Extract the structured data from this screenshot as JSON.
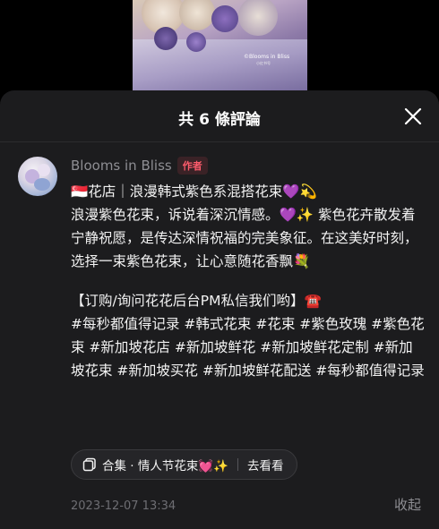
{
  "video": {
    "watermark": "©Blooms in Bliss",
    "watermark_sub": "小红书号"
  },
  "sheet": {
    "title": "共 6 條評論"
  },
  "comment": {
    "author": "Blooms in Bliss",
    "author_badge": "作者",
    "line1": "🇸🇬花店｜浪漫韩式紫色系混搭花束💜💫",
    "line2": "浪漫紫色花束，诉说着深沉情感。💜✨ 紫色花卉散发着宁静祝愿，是传达深情祝福的完美象征。在这美好时刻，选择一束紫色花束，让心意随花香飘💐",
    "line3": "【订购/询问花花后台PM私信我们哟】☎️",
    "hashtags": "#每秒都值得记录 #韩式花束 #花束 #紫色玫瑰 #紫色花束 #新加坡花店 #新加坡鲜花 #新加坡鲜花定制 #新加坡花束 #新加坡买花 #新加坡鲜花配送 #每秒都值得记录",
    "collection_label": "合集 · 情人节花束💓✨",
    "collection_action": "去看看",
    "timestamp": "2023-12-07 13:34",
    "collapse_label": "收起"
  },
  "colors": {
    "sheet_bg": "#1c1c1e",
    "author_badge": "#ff5c6c",
    "muted_text": "#8e8e93"
  }
}
